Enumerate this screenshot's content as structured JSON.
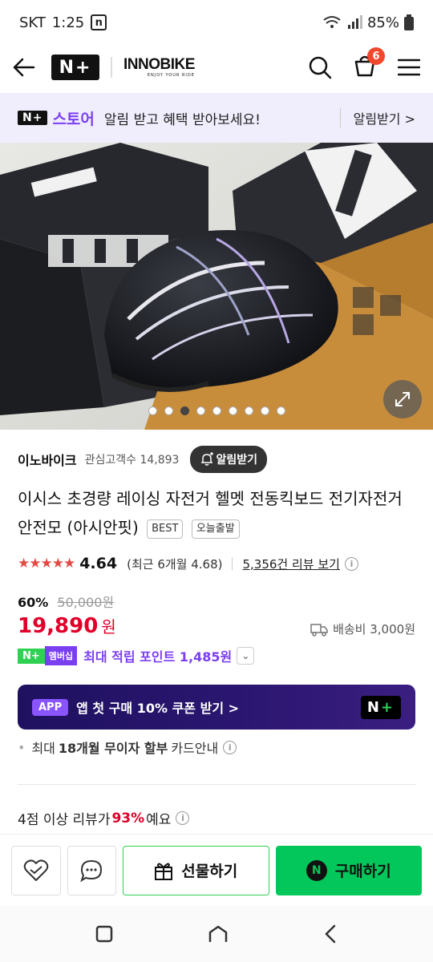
{
  "status_bar": {
    "carrier": "SKT",
    "time": "1:25",
    "notif": "n",
    "battery": "85%"
  },
  "nav": {
    "logo_nplus": "N+",
    "brand": "INNOBIKE",
    "brand_tagline": "ENJOY YOUR RIDE",
    "cart_count": "6"
  },
  "alert_bar": {
    "badge": "N+",
    "store": "스토어",
    "message": "알림 받고 혜택 받아보세요!",
    "cta": "알림받기 >"
  },
  "gallery": {
    "slide_count": 9,
    "active_index": 2
  },
  "seller": {
    "name": "이노바이크",
    "followers": "관심고객수 14,893",
    "follow_button": "알림받기"
  },
  "product": {
    "title": "이시스 초경량 레이싱 자전거 헬멧 전동킥보드 전기자전거 안전모 (아시안핏)",
    "tags": [
      "BEST",
      "오늘출발"
    ],
    "stars": "★★★★★",
    "rating": "4.64",
    "recent_rating": "(최근 6개월 4.68)",
    "review_link": "5,356건 리뷰 보기",
    "discount": "60%",
    "original_price": "50,000원",
    "price": "19,890",
    "currency": "원",
    "shipping": "배송비 3,000원",
    "points_member": "멤버십",
    "points_text": "최대 적립 포인트 1,485원",
    "app_badge": "APP",
    "app_coupon": "앱 첫 구매 10% 쿠폰 받기 >",
    "installment_pre": "최대",
    "installment_bold": "18개월 무이자 할부",
    "installment_post": "카드안내",
    "review_stat_pre": "4점 이상 리뷰가",
    "review_stat_pct": "93%",
    "review_stat_post": "예요"
  },
  "actions": {
    "gift": "선물하기",
    "buy": "구매하기"
  },
  "colors": {
    "naver_green": "#03c75a",
    "purple": "#7b3ff2",
    "price_red": "#e0002a"
  }
}
